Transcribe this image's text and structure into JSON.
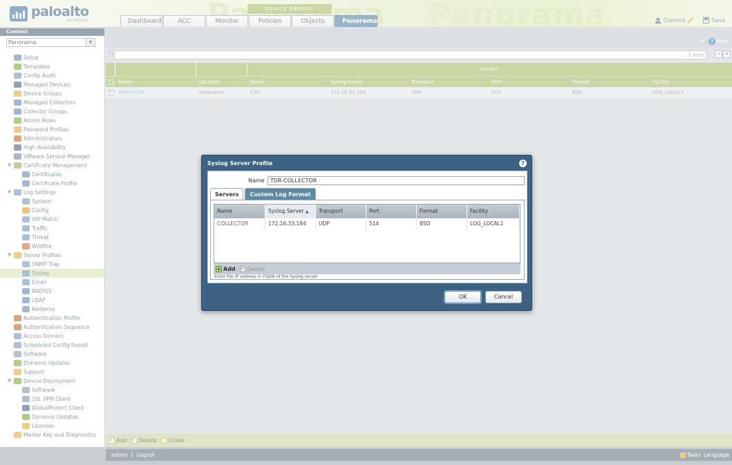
{
  "header": {
    "logo_text": "paloalto",
    "logo_sub": "NETWORKS",
    "device_groups_label": "DEVICE GROUPS",
    "tabs": [
      {
        "label": "Dashboard"
      },
      {
        "label": "ACC"
      },
      {
        "label": "Monitor"
      },
      {
        "label": "Policies"
      },
      {
        "label": "Objects"
      },
      {
        "label": "Panorama"
      }
    ],
    "commit_label": "Commit",
    "save_label": "Save"
  },
  "sidebar": {
    "context_label": "Context",
    "context_value": "Panorama",
    "items": [
      {
        "label": "Setup"
      },
      {
        "label": "Templates"
      },
      {
        "label": "Config Audit"
      },
      {
        "label": "Managed Devices"
      },
      {
        "label": "Device Groups"
      },
      {
        "label": "Managed Collectors"
      },
      {
        "label": "Collector Groups"
      },
      {
        "label": "Admin Roles"
      },
      {
        "label": "Password Profiles"
      },
      {
        "label": "Administrators"
      },
      {
        "label": "High Availability"
      },
      {
        "label": "VMware Service Manager"
      },
      {
        "label": "Certificate Management"
      },
      {
        "label": "Certificates"
      },
      {
        "label": "Certificate Profile"
      },
      {
        "label": "Log Settings"
      },
      {
        "label": "System"
      },
      {
        "label": "Config"
      },
      {
        "label": "HIP Match"
      },
      {
        "label": "Traffic"
      },
      {
        "label": "Threat"
      },
      {
        "label": "Wildfire"
      },
      {
        "label": "Server Profiles"
      },
      {
        "label": "SNMP Trap"
      },
      {
        "label": "Syslog"
      },
      {
        "label": "Email"
      },
      {
        "label": "RADIUS"
      },
      {
        "label": "LDAP"
      },
      {
        "label": "Kerberos"
      },
      {
        "label": "Authentication Profile"
      },
      {
        "label": "Authentication Sequence"
      },
      {
        "label": "Access Domain"
      },
      {
        "label": "Scheduled Config Export"
      },
      {
        "label": "Software"
      },
      {
        "label": "Dynamic Updates"
      },
      {
        "label": "Support"
      },
      {
        "label": "Device Deployment"
      },
      {
        "label": "Software"
      },
      {
        "label": "SSL VPN Client"
      },
      {
        "label": "GlobalProtect Client"
      },
      {
        "label": "Dynamic Updates"
      },
      {
        "label": "Licenses"
      },
      {
        "label": "Master Key and Diagnostics"
      }
    ]
  },
  "main": {
    "help_label": "Help",
    "filter_count": "1 item",
    "group_header": "Servers",
    "columns": [
      "Name",
      "Location",
      "Name",
      "Syslog Server",
      "Transport",
      "Port",
      "Format",
      "Facility"
    ],
    "rows": [
      {
        "name": "SIMRX-CTA",
        "location": "Panorama",
        "server_name": "CTA",
        "syslog_server": "172.16.33.184",
        "transport": "UDP",
        "port": "514",
        "format": "BSD",
        "facility": "LOG_LOCAL1"
      }
    ],
    "add_label": "Add",
    "delete_label": "Delete",
    "clone_label": "Clone"
  },
  "statusbar": {
    "user": "admin",
    "logout": "Logout",
    "tasks": "Tasks",
    "language": "Language"
  },
  "dialog": {
    "title": "Syslog Server Profile",
    "name_label": "Name",
    "name_value": "TDR-COLLECTOR",
    "tabs": [
      "Servers",
      "Custom Log Format"
    ],
    "columns": [
      "Name",
      "Syslog Server",
      "Transport",
      "Port",
      "Format",
      "Facility"
    ],
    "rows": [
      {
        "name": "COLLECTOR",
        "syslog_server": "172.16.33.184",
        "transport": "UDP",
        "port": "514",
        "format": "BSD",
        "facility": "LOG_LOCAL1"
      }
    ],
    "add_label": "Add",
    "delete_label": "Delete",
    "hint": "Enter the IP address or FQDN of the Syslog server",
    "ok_label": "OK",
    "cancel_label": "Cancel"
  },
  "colors": {
    "accent_green": "#a9c06b",
    "accent_blue": "#3c6285",
    "link_blue": "#3f82c0"
  }
}
